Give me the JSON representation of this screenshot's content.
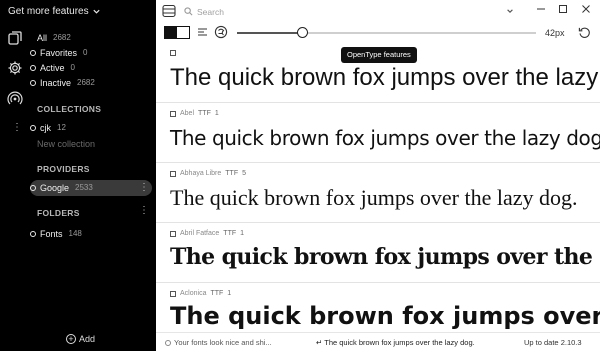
{
  "sidebar": {
    "menu_label": "Get more features",
    "filters": [
      {
        "label": "All",
        "count": "2682"
      },
      {
        "label": "Favorites",
        "count": "0"
      },
      {
        "label": "Active",
        "count": "0"
      },
      {
        "label": "Inactive",
        "count": "2682"
      }
    ],
    "collections_heading": "COLLECTIONS",
    "collections": [
      {
        "label": "cjk",
        "count": "12"
      }
    ],
    "new_collection": "New collection",
    "providers_heading": "PROVIDERS",
    "providers": [
      {
        "label": "Google",
        "count": "2533"
      }
    ],
    "folders_heading": "FOLDERS",
    "folders": [
      {
        "label": "Fonts",
        "count": "148"
      }
    ],
    "add_label": "Add",
    "icons": [
      "collection-icon",
      "gear-icon",
      "broadcast-icon",
      "more-icon"
    ]
  },
  "search": {
    "placeholder": "Search"
  },
  "toolbar": {
    "font_size": "42px",
    "size_slider_fraction": 0.22,
    "tooltip": "OpenType features"
  },
  "fonts": [
    {
      "name": "",
      "format": "",
      "styles": "",
      "sample": "The quick brown fox jumps over the lazy dog."
    },
    {
      "name": "Abel",
      "format": "TTF",
      "styles": "1",
      "sample": "The quick brown fox jumps over the lazy dog."
    },
    {
      "name": "Abhaya Libre",
      "format": "TTF",
      "styles": "5",
      "sample": "The quick brown fox jumps over the lazy dog."
    },
    {
      "name": "Abril Fatface",
      "format": "TTF",
      "styles": "1",
      "sample": "The quick brown fox jumps over the lazy dog."
    },
    {
      "name": "Aclonica",
      "format": "TTF",
      "styles": "1",
      "sample": "The quick brown fox jumps over the lazy dog."
    }
  ],
  "statusbar": {
    "preview_text": "Your fonts look nice and shi...",
    "sample_text": "The quick brown fox jumps over the lazy dog.",
    "update_status": "Up to date 2.10.3"
  },
  "colors": {
    "sidebar_bg": "#000000",
    "main_bg": "#ffffff",
    "active_row": "#3a3a3a"
  }
}
